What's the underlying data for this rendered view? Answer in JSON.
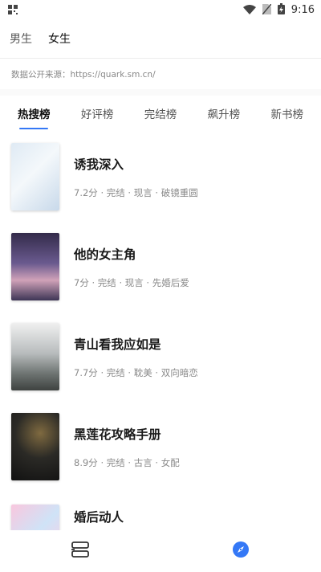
{
  "status_bar": {
    "time": "9:16"
  },
  "gender_tabs": [
    {
      "label": "男生",
      "active": false
    },
    {
      "label": "女生",
      "active": true
    }
  ],
  "source_text": "数据公开来源：https://quark.sm.cn/",
  "rank_tabs": [
    {
      "label": "热搜榜",
      "active": true
    },
    {
      "label": "好评榜",
      "active": false
    },
    {
      "label": "完结榜",
      "active": false
    },
    {
      "label": "飙升榜",
      "active": false
    },
    {
      "label": "新书榜",
      "active": false
    }
  ],
  "books": [
    {
      "title": "诱我深入",
      "meta": "7.2分 · 完结 · 现言 · 破镜重圆"
    },
    {
      "title": "他的女主角",
      "meta": "7分 · 完结 · 现言 · 先婚后爱"
    },
    {
      "title": "青山看我应如是",
      "meta": "7.7分 · 完结 · 耽美 · 双向暗恋"
    },
    {
      "title": "黑莲花攻略手册",
      "meta": "8.9分 · 完结 · 古言 · 女配"
    },
    {
      "title": "婚后动人",
      "meta": ""
    }
  ],
  "colors": {
    "accent": "#3478f6"
  },
  "icons": {
    "bookshelf": "bookshelf-icon",
    "discover": "compass-icon"
  }
}
